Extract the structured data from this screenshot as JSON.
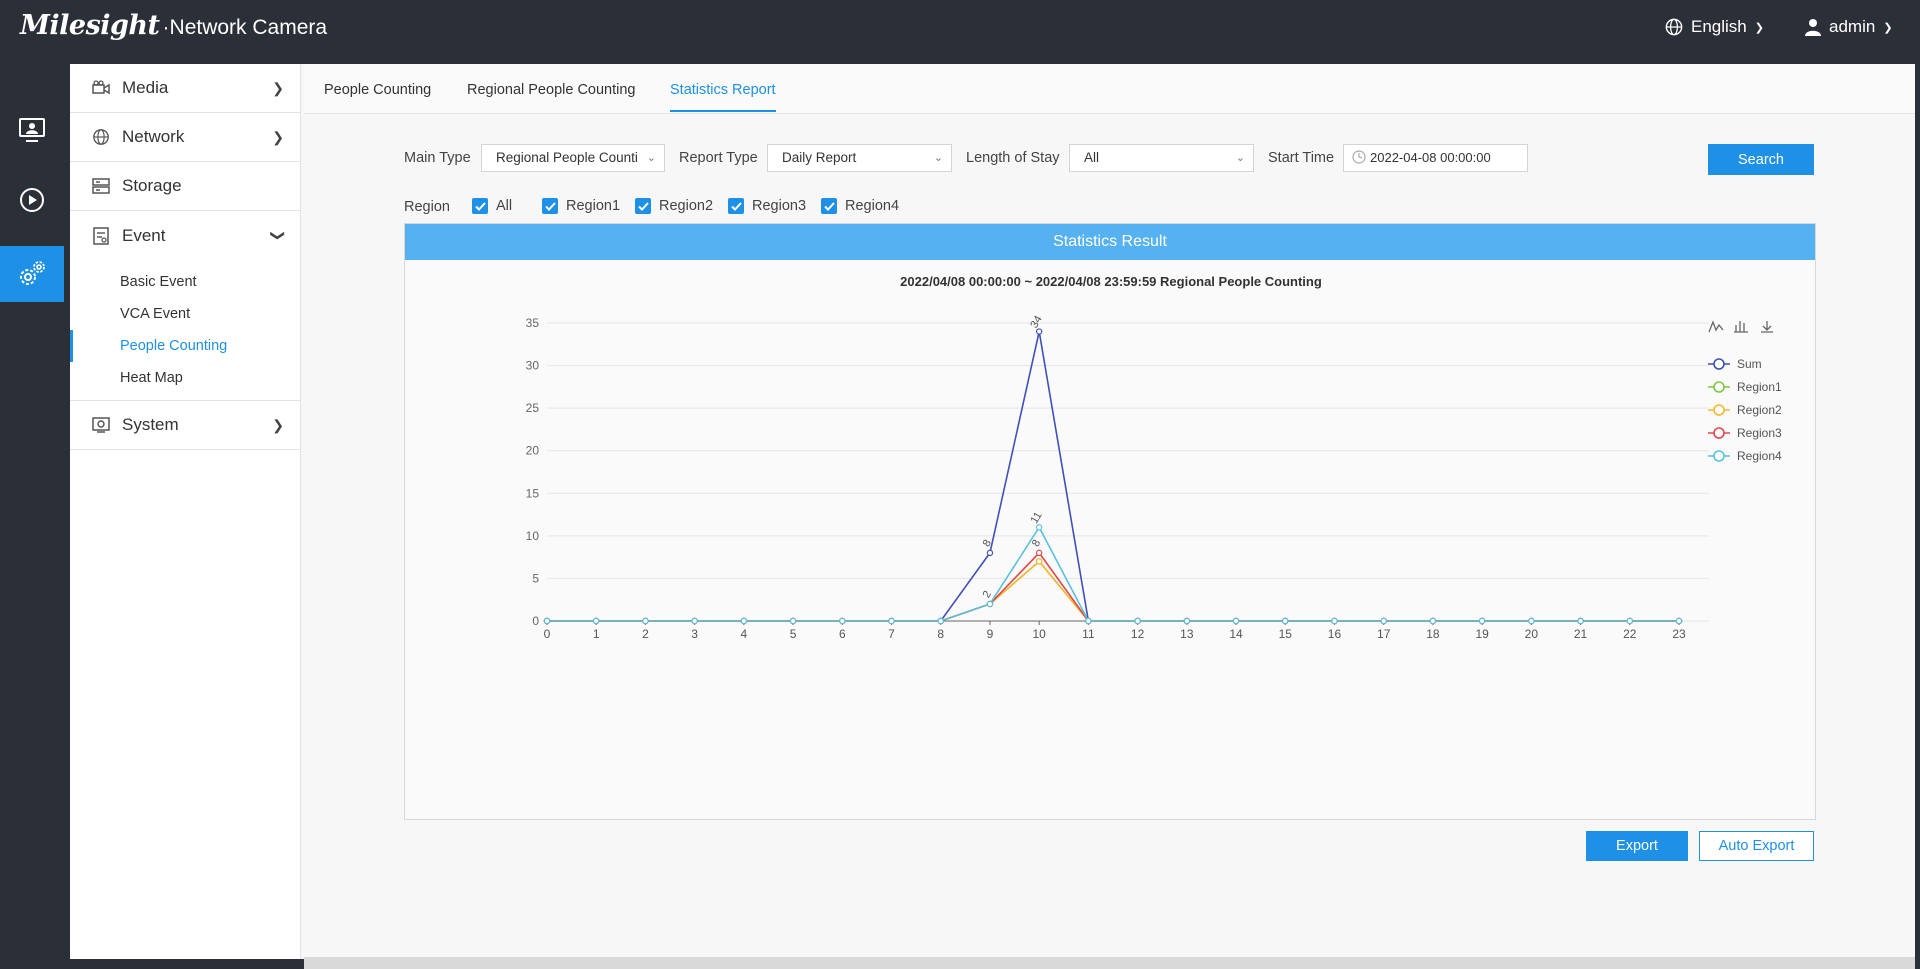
{
  "header": {
    "brand": "Milesight",
    "product": "·Network Camera",
    "language": "English",
    "user": "admin"
  },
  "rail": [
    {
      "icon": "monitor-icon"
    },
    {
      "icon": "playback-icon"
    },
    {
      "icon": "settings-icon",
      "active": true
    }
  ],
  "menu": {
    "items": [
      {
        "label": "Media"
      },
      {
        "label": "Network"
      },
      {
        "label": "Storage"
      },
      {
        "label": "Event"
      },
      {
        "label": "System"
      }
    ],
    "event_sub": [
      {
        "label": "Basic Event"
      },
      {
        "label": "VCA Event"
      },
      {
        "label": "People Counting",
        "active": true
      },
      {
        "label": "Heat Map"
      }
    ]
  },
  "tabs": [
    {
      "label": "People Counting"
    },
    {
      "label": "Regional People Counting"
    },
    {
      "label": "Statistics Report",
      "active": true
    }
  ],
  "filters": {
    "main_type_label": "Main Type",
    "main_type_value": "Regional People Counti",
    "report_type_label": "Report Type",
    "report_type_value": "Daily Report",
    "length_of_stay_label": "Length of Stay",
    "length_of_stay_value": "All",
    "start_time_label": "Start Time",
    "start_time_value": "2022-04-08 00:00:00",
    "search_label": "Search"
  },
  "region": {
    "label": "Region",
    "options": [
      "All",
      "Region1",
      "Region2",
      "Region3",
      "Region4"
    ]
  },
  "result": {
    "header": "Statistics Result",
    "export_label": "Export",
    "auto_export_label": "Auto Export"
  },
  "colors": {
    "accent": "#1e90e6",
    "sum": "#3f51b5",
    "region1": "#7ac943",
    "region2": "#f7b733",
    "region3": "#e0474c",
    "region4": "#5bc0de"
  },
  "chart_data": {
    "type": "line",
    "title": "2022/04/08 00:00:00  ~  2022/04/08 23:59:59 Regional People Counting",
    "x": [
      0,
      1,
      2,
      3,
      4,
      5,
      6,
      7,
      8,
      9,
      10,
      11,
      12,
      13,
      14,
      15,
      16,
      17,
      18,
      19,
      20,
      21,
      22,
      23
    ],
    "ylim": [
      0,
      35
    ],
    "yticks": [
      0,
      5,
      10,
      15,
      20,
      25,
      30,
      35
    ],
    "grid": true,
    "legend_position": "right",
    "series": [
      {
        "name": "Sum",
        "color": "#3f51b5",
        "values": [
          0,
          0,
          0,
          0,
          0,
          0,
          0,
          0,
          0,
          8,
          34,
          0,
          0,
          0,
          0,
          0,
          0,
          0,
          0,
          0,
          0,
          0,
          0,
          0
        ]
      },
      {
        "name": "Region1",
        "color": "#7ac943",
        "values": [
          0,
          0,
          0,
          0,
          0,
          0,
          0,
          0,
          0,
          2,
          7,
          0,
          0,
          0,
          0,
          0,
          0,
          0,
          0,
          0,
          0,
          0,
          0,
          0
        ]
      },
      {
        "name": "Region2",
        "color": "#f7b733",
        "values": [
          0,
          0,
          0,
          0,
          0,
          0,
          0,
          0,
          0,
          2,
          7,
          0,
          0,
          0,
          0,
          0,
          0,
          0,
          0,
          0,
          0,
          0,
          0,
          0
        ]
      },
      {
        "name": "Region3",
        "color": "#e0474c",
        "values": [
          0,
          0,
          0,
          0,
          0,
          0,
          0,
          0,
          0,
          2,
          8,
          0,
          0,
          0,
          0,
          0,
          0,
          0,
          0,
          0,
          0,
          0,
          0,
          0
        ]
      },
      {
        "name": "Region4",
        "color": "#5bc0de",
        "values": [
          0,
          0,
          0,
          0,
          0,
          0,
          0,
          0,
          0,
          2,
          11,
          0,
          0,
          0,
          0,
          0,
          0,
          0,
          0,
          0,
          0,
          0,
          0,
          0
        ]
      }
    ],
    "data_labels": [
      {
        "x": 9,
        "y": 8,
        "label": "8"
      },
      {
        "x": 9,
        "y": 2,
        "label": "2"
      },
      {
        "x": 10,
        "y": 34,
        "label": "34"
      },
      {
        "x": 10,
        "y": 11,
        "label": "11"
      },
      {
        "x": 10,
        "y": 8,
        "label": "8"
      }
    ]
  }
}
